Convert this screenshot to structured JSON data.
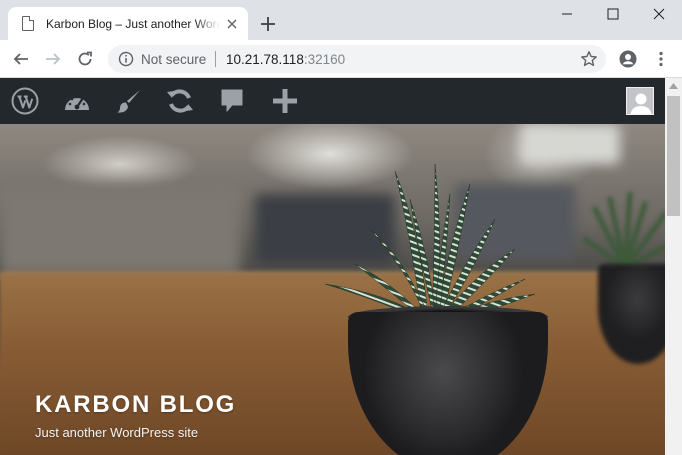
{
  "browser": {
    "tab": {
      "title": "Karbon Blog – Just another WordPress site",
      "favicon": "page-icon",
      "close_icon": "close-icon"
    },
    "new_tab_icon": "plus-icon",
    "window_controls": [
      "minimize-icon",
      "maximize-icon",
      "close-icon"
    ],
    "toolbar": {
      "back_icon": "arrow-left-icon",
      "forward_icon": "arrow-right-icon",
      "reload_icon": "reload-icon",
      "security_label": "Not secure",
      "url_host": "10.21.78.118",
      "url_port": ":32160",
      "bookmark_icon": "star-icon",
      "profile_icon": "account-circle-icon",
      "menu_icon": "kebab-menu-icon"
    }
  },
  "admin_bar": {
    "items": [
      "wordpress-logo-icon",
      "dashboard-icon",
      "customize-brush-icon",
      "updates-icon",
      "comments-icon",
      "new-content-plus-icon"
    ],
    "account_icon": "avatar"
  },
  "hero": {
    "site_title": "Karbon Blog",
    "site_description": "Just another WordPress site"
  },
  "colors": {
    "tabstrip": "#dee1e6",
    "admin_bar": "#23282d",
    "admin_icon": "#9ca1a8"
  }
}
